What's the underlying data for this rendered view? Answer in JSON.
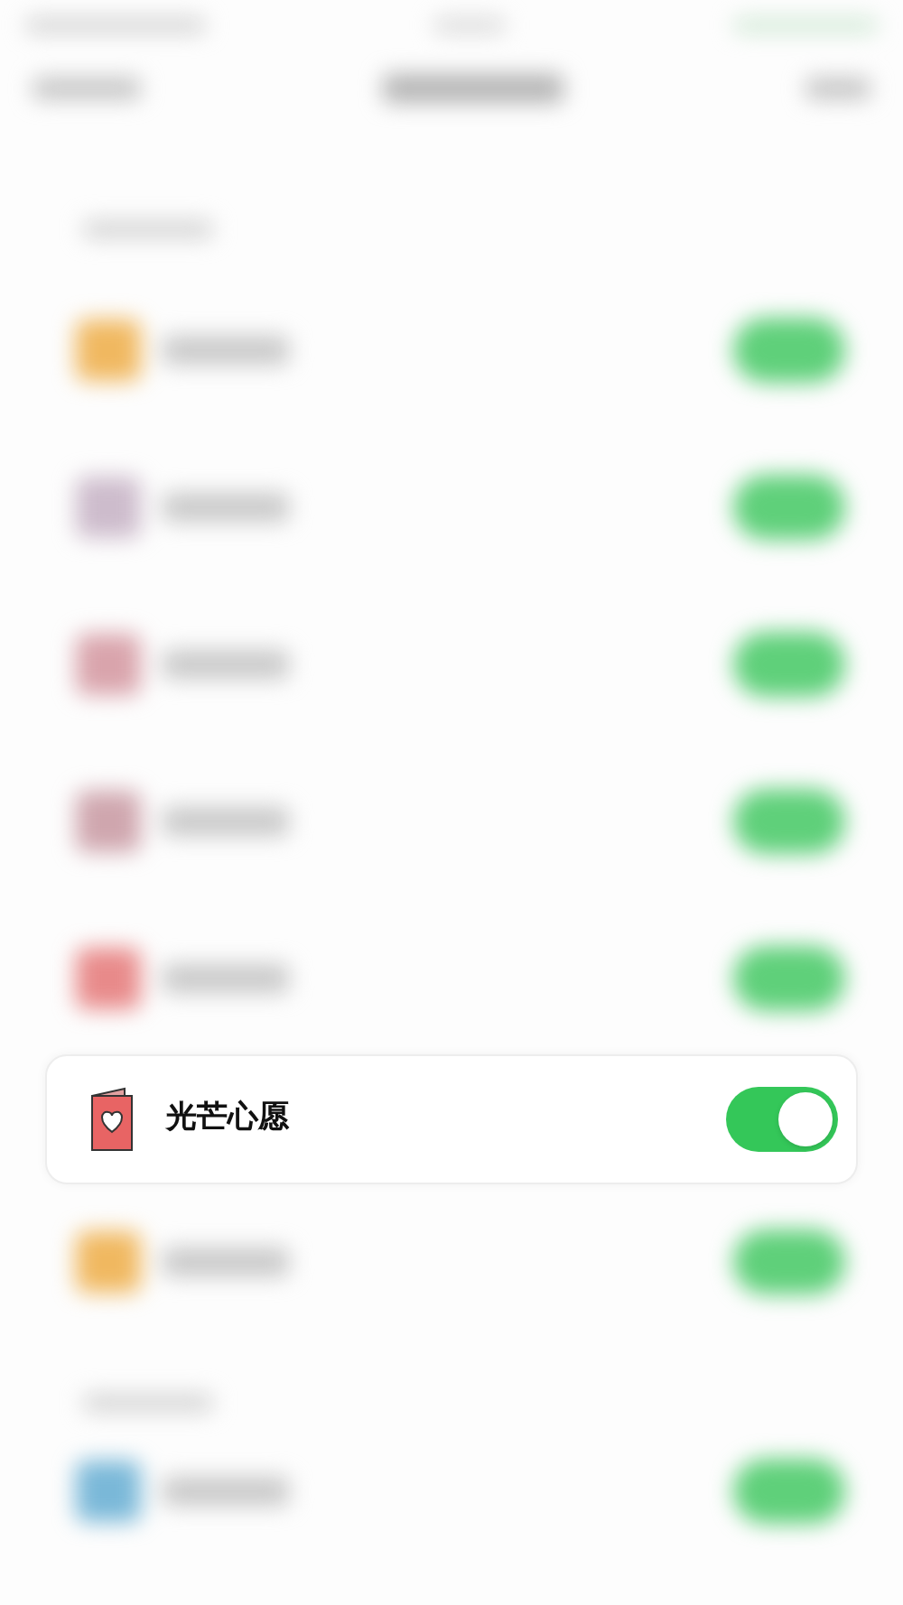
{
  "rows_before": [
    {
      "color": "#f0b860",
      "on": true
    },
    {
      "color": "#cdbccc",
      "on": true
    },
    {
      "color": "#d9a4ac",
      "on": true
    },
    {
      "color": "#cfa6ae",
      "on": true
    },
    {
      "color": "#e88a8a",
      "on": true
    }
  ],
  "focused_row": {
    "label": "光芒心愿",
    "on": true
  },
  "rows_after": [
    {
      "color": "#f0b860",
      "on": true
    }
  ],
  "second_section_rows": [
    {
      "color": "#7ab8d8",
      "on": true
    }
  ]
}
